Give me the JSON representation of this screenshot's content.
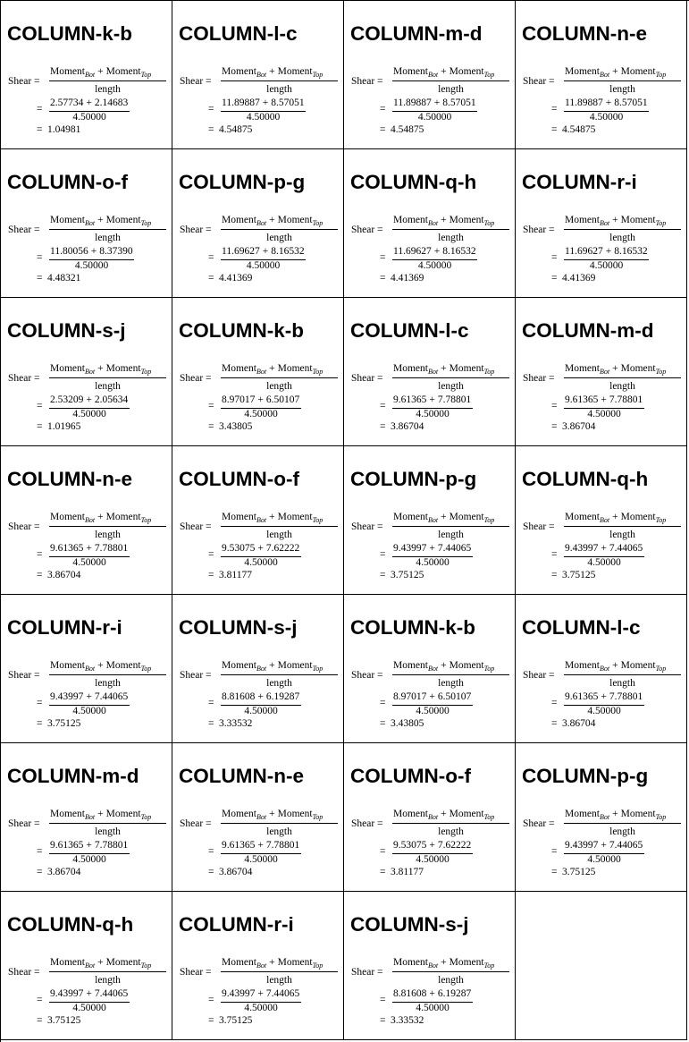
{
  "formula": {
    "lhs": "Shear",
    "eq": "=",
    "moment": "Moment",
    "bot": "Bot",
    "top": "Top",
    "plus": "+",
    "length_label": "length"
  },
  "cells": [
    {
      "title": "COLUMN-k-b",
      "bot": "2.57734",
      "top": "2.14683",
      "length": "4.50000",
      "result": "1.04981"
    },
    {
      "title": "COLUMN-l-c",
      "bot": "11.89887",
      "top": "8.57051",
      "length": "4.50000",
      "result": "4.54875"
    },
    {
      "title": "COLUMN-m-d",
      "bot": "11.89887",
      "top": "8.57051",
      "length": "4.50000",
      "result": "4.54875"
    },
    {
      "title": "COLUMN-n-e",
      "bot": "11.89887",
      "top": "8.57051",
      "length": "4.50000",
      "result": "4.54875"
    },
    {
      "title": "COLUMN-o-f",
      "bot": "11.80056",
      "top": "8.37390",
      "length": "4.50000",
      "result": "4.48321"
    },
    {
      "title": "COLUMN-p-g",
      "bot": "11.69627",
      "top": "8.16532",
      "length": "4.50000",
      "result": "4.41369"
    },
    {
      "title": "COLUMN-q-h",
      "bot": "11.69627",
      "top": "8.16532",
      "length": "4.50000",
      "result": "4.41369"
    },
    {
      "title": "COLUMN-r-i",
      "bot": "11.69627",
      "top": "8.16532",
      "length": "4.50000",
      "result": "4.41369"
    },
    {
      "title": "COLUMN-s-j",
      "bot": "2.53209",
      "top": "2.05634",
      "length": "4.50000",
      "result": "1.01965"
    },
    {
      "title": "COLUMN-k-b",
      "bot": "8.97017",
      "top": "6.50107",
      "length": "4.50000",
      "result": "3.43805"
    },
    {
      "title": "COLUMN-l-c",
      "bot": "9.61365",
      "top": "7.78801",
      "length": "4.50000",
      "result": "3.86704"
    },
    {
      "title": "COLUMN-m-d",
      "bot": "9.61365",
      "top": "7.78801",
      "length": "4.50000",
      "result": "3.86704"
    },
    {
      "title": "COLUMN-n-e",
      "bot": "9.61365",
      "top": "7.78801",
      "length": "4.50000",
      "result": "3.86704"
    },
    {
      "title": "COLUMN-o-f",
      "bot": "9.53075",
      "top": "7.62222",
      "length": "4.50000",
      "result": "3.81177"
    },
    {
      "title": "COLUMN-p-g",
      "bot": "9.43997",
      "top": "7.44065",
      "length": "4.50000",
      "result": "3.75125"
    },
    {
      "title": "COLUMN-q-h",
      "bot": "9.43997",
      "top": "7.44065",
      "length": "4.50000",
      "result": "3.75125"
    },
    {
      "title": "COLUMN-r-i",
      "bot": "9.43997",
      "top": "7.44065",
      "length": "4.50000",
      "result": "3.75125"
    },
    {
      "title": "COLUMN-s-j",
      "bot": "8.81608",
      "top": "6.19287",
      "length": "4.50000",
      "result": "3.33532"
    },
    {
      "title": "COLUMN-k-b",
      "bot": "8.97017",
      "top": "6.50107",
      "length": "4.50000",
      "result": "3.43805"
    },
    {
      "title": "COLUMN-l-c",
      "bot": "9.61365",
      "top": "7.78801",
      "length": "4.50000",
      "result": "3.86704"
    },
    {
      "title": "COLUMN-m-d",
      "bot": "9.61365",
      "top": "7.78801",
      "length": "4.50000",
      "result": "3.86704"
    },
    {
      "title": "COLUMN-n-e",
      "bot": "9.61365",
      "top": "7.78801",
      "length": "4.50000",
      "result": "3.86704"
    },
    {
      "title": "COLUMN-o-f",
      "bot": "9.53075",
      "top": "7.62222",
      "length": "4.50000",
      "result": "3.81177"
    },
    {
      "title": "COLUMN-p-g",
      "bot": "9.43997",
      "top": "7.44065",
      "length": "4.50000",
      "result": "3.75125"
    },
    {
      "title": "COLUMN-q-h",
      "bot": "9.43997",
      "top": "7.44065",
      "length": "4.50000",
      "result": "3.75125"
    },
    {
      "title": "COLUMN-r-i",
      "bot": "9.43997",
      "top": "7.44065",
      "length": "4.50000",
      "result": "3.75125"
    },
    {
      "title": "COLUMN-s-j",
      "bot": "8.81608",
      "top": "6.19287",
      "length": "4.50000",
      "result": "3.33532"
    }
  ]
}
